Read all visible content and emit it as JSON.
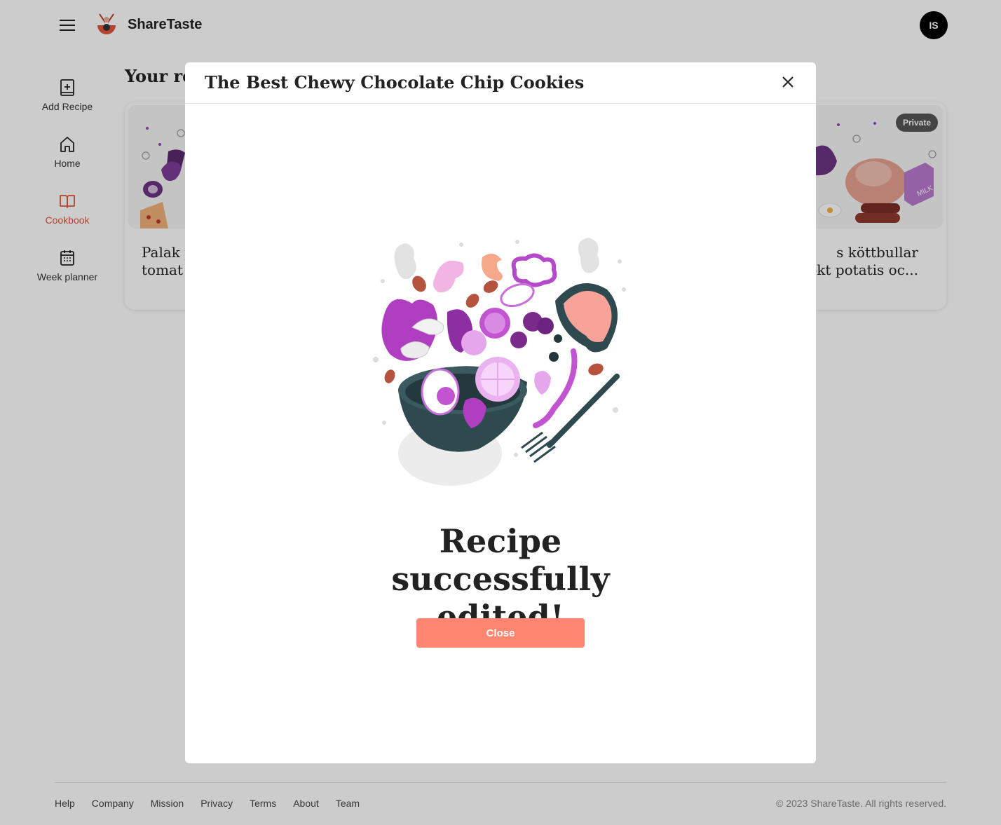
{
  "app": {
    "brand": "ShareTaste",
    "user_initials": "IS"
  },
  "sidebar": {
    "items": [
      {
        "label": "Add Recipe",
        "icon": "book-plus-icon",
        "active": false
      },
      {
        "label": "Home",
        "icon": "home-icon",
        "active": false
      },
      {
        "label": "Cookbook",
        "icon": "open-book-icon",
        "active": true
      },
      {
        "label": "Week planner",
        "icon": "calendar-icon",
        "active": false
      }
    ]
  },
  "main": {
    "section_title": "Your re",
    "cards": [
      {
        "title": "Palak p\ntomat"
      },
      {
        "title": "s köttbullar\nokt potatis oc...",
        "badge": "Private"
      }
    ]
  },
  "modal": {
    "title": "The Best Chewy Chocolate Chip Cookies",
    "message": "Recipe successfully edited!",
    "close_label": "Close"
  },
  "footer": {
    "links": [
      "Help",
      "Company",
      "Mission",
      "Privacy",
      "Terms",
      "About",
      "Team"
    ],
    "copyright": "© 2023 ShareTaste. All rights reserved."
  },
  "colors": {
    "accent": "#ff8671",
    "active_nav": "#e0533c",
    "overlay": "rgba(0,0,0,0.2)"
  }
}
